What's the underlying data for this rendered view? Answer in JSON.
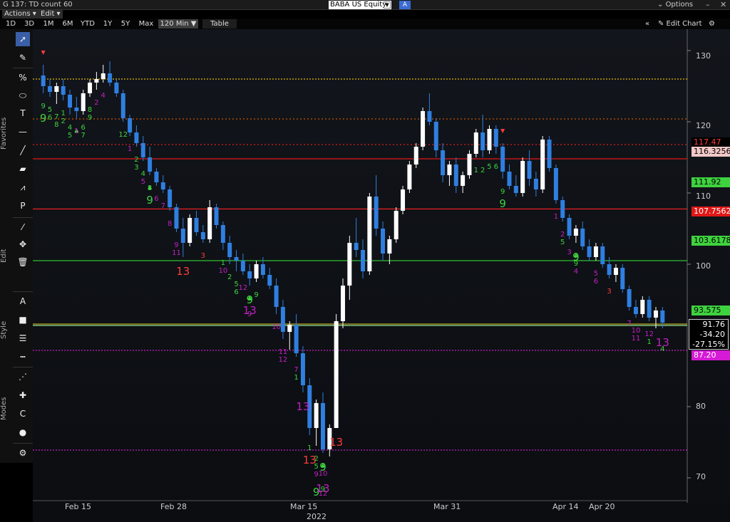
{
  "window": {
    "title": "G 137: TD count 60",
    "security": "BABA US Equity",
    "a_button": "A",
    "options_label": "Options",
    "controls": [
      "–",
      "✕"
    ]
  },
  "menu": {
    "actions": "Actions ▾",
    "edit": "Edit ▾"
  },
  "ranges": [
    "1D",
    "3D",
    "1M",
    "6M",
    "YTD",
    "1Y",
    "5Y",
    "Max",
    "120 Min ▼"
  ],
  "selected_range": "120 Min ▼",
  "table_label": "Table",
  "edit_chart_label": "✎ Edit Chart",
  "toolbar": {
    "groups": [
      "Favorites",
      "Edit",
      "Style",
      "Modes"
    ],
    "tools": [
      "pointer-tool",
      "pencil-tool",
      "percent-tool",
      "ellipse-tool",
      "text-tool",
      "horizontal-line-tool",
      "trend-line-tool",
      "channel-tool",
      "polyline-tool",
      "label-tool",
      "brush-tool",
      "move-tool",
      "delete-tool",
      "annotate-tool",
      "fill-tool",
      "line-weight-tool",
      "line-style-tool",
      "dashed-line-tool",
      "crosshair-tool",
      "magnet-tool",
      "colors-tool",
      "settings-tool"
    ]
  },
  "axes": {
    "y_ticks": [
      "130",
      "120",
      "110",
      "100",
      "80",
      "70"
    ],
    "x_ticks": [
      "Feb 15",
      "Feb 28",
      "Mar 15",
      "Mar 31",
      "Apr 14",
      "Apr 20"
    ],
    "year": "2022"
  },
  "price_tags": [
    {
      "value": "117.47",
      "fg": "#ff3b3b",
      "bg": "#000000"
    },
    {
      "value": "116.3256",
      "fg": "#000000",
      "bg": "#f2c7c7"
    },
    {
      "value": "111.92",
      "fg": "#000000",
      "bg": "#3fd23f"
    },
    {
      "value": "107.7562",
      "fg": "#ffffff",
      "bg": "#e01818"
    },
    {
      "value": "103.6178",
      "fg": "#000000",
      "bg": "#3fd23f"
    },
    {
      "value": "93.575",
      "fg": "#000000",
      "bg": "#3fd23f"
    },
    {
      "value": "87.20",
      "fg": "#ffffff",
      "bg": "#d61ad6"
    }
  ],
  "last_quote": {
    "price": "91.76",
    "change": "-34.20",
    "pct": "-27.15%"
  },
  "chart_data": {
    "type": "candlestick",
    "ylim": [
      67,
      133
    ],
    "colors": {
      "up": "#ffffff",
      "down": "#2f7fe0"
    },
    "candles": [
      [
        126.5,
        128.0,
        124.0,
        125.0
      ],
      [
        125.0,
        126.0,
        123.5,
        124.2
      ],
      [
        124.2,
        125.5,
        122.5,
        125.0
      ],
      [
        125.0,
        126.0,
        123.0,
        123.8
      ],
      [
        123.8,
        124.5,
        121.0,
        122.0
      ],
      [
        122.0,
        123.5,
        120.5,
        121.5
      ],
      [
        121.5,
        124.5,
        121.0,
        124.0
      ],
      [
        124.0,
        126.0,
        123.5,
        125.5
      ],
      [
        125.5,
        127.0,
        124.5,
        126.0
      ],
      [
        126.0,
        128.0,
        125.5,
        126.8
      ],
      [
        126.8,
        128.5,
        125.0,
        125.5
      ],
      [
        125.5,
        126.0,
        123.5,
        124.0
      ],
      [
        124.0,
        124.5,
        120.0,
        120.5
      ],
      [
        120.5,
        121.0,
        118.0,
        118.5
      ],
      [
        118.5,
        119.5,
        116.5,
        117.0
      ],
      [
        117.0,
        118.0,
        114.5,
        115.0
      ],
      [
        115.0,
        116.5,
        112.5,
        113.0
      ],
      [
        113.0,
        113.5,
        111.0,
        111.5
      ],
      [
        111.5,
        112.5,
        110.0,
        110.5
      ],
      [
        110.5,
        111.0,
        107.5,
        108.0
      ],
      [
        108.0,
        108.5,
        104.5,
        105.0
      ],
      [
        105.0,
        106.5,
        101.0,
        103.0
      ],
      [
        103.0,
        107.0,
        102.5,
        106.5
      ],
      [
        106.5,
        107.5,
        104.0,
        104.5
      ],
      [
        104.5,
        105.5,
        103.0,
        103.5
      ],
      [
        103.5,
        109.0,
        103.0,
        108.0
      ],
      [
        108.0,
        108.5,
        105.0,
        105.5
      ],
      [
        105.5,
        106.0,
        102.0,
        103.0
      ],
      [
        103.0,
        104.0,
        100.0,
        101.0
      ],
      [
        101.0,
        102.0,
        99.0,
        100.5
      ],
      [
        100.5,
        101.5,
        98.5,
        99.0
      ],
      [
        99.0,
        100.0,
        97.0,
        98.0
      ],
      [
        98.0,
        100.5,
        97.5,
        100.0
      ],
      [
        100.0,
        101.0,
        98.0,
        98.5
      ],
      [
        98.5,
        99.5,
        96.5,
        97.0
      ],
      [
        97.0,
        98.0,
        93.0,
        94.0
      ],
      [
        94.0,
        95.0,
        89.5,
        90.5
      ],
      [
        90.5,
        92.0,
        88.0,
        91.5
      ],
      [
        91.5,
        93.0,
        87.0,
        87.5
      ],
      [
        87.5,
        88.5,
        82.0,
        83.0
      ],
      [
        83.0,
        84.0,
        76.0,
        77.0
      ],
      [
        77.0,
        81.0,
        74.5,
        80.5
      ],
      [
        80.5,
        82.0,
        73.5,
        74.0
      ],
      [
        74.0,
        77.5,
        73.0,
        77.0
      ],
      [
        77.0,
        93.0,
        77.0,
        92.0
      ],
      [
        92.0,
        98.0,
        91.0,
        97.0
      ],
      [
        97.0,
        104.0,
        95.0,
        103.0
      ],
      [
        103.0,
        106.5,
        101.0,
        102.0
      ],
      [
        102.0,
        103.5,
        98.0,
        99.0
      ],
      [
        99.0,
        110.0,
        98.5,
        109.5
      ],
      [
        109.5,
        112.5,
        104.0,
        105.0
      ],
      [
        105.0,
        106.0,
        100.5,
        101.5
      ],
      [
        101.5,
        104.0,
        100.0,
        103.5
      ],
      [
        103.5,
        108.0,
        103.0,
        107.5
      ],
      [
        107.5,
        111.0,
        107.0,
        110.5
      ],
      [
        110.5,
        114.5,
        110.0,
        114.0
      ],
      [
        114.0,
        117.0,
        113.5,
        116.5
      ],
      [
        116.5,
        122.0,
        116.0,
        121.5
      ],
      [
        121.5,
        124.0,
        119.5,
        120.0
      ],
      [
        120.0,
        120.5,
        115.0,
        116.0
      ],
      [
        116.0,
        117.0,
        111.5,
        112.5
      ],
      [
        112.5,
        114.5,
        111.0,
        114.0
      ],
      [
        114.0,
        115.0,
        110.0,
        111.0
      ],
      [
        111.0,
        113.0,
        110.0,
        112.5
      ],
      [
        112.5,
        116.0,
        112.0,
        115.5
      ],
      [
        115.5,
        119.0,
        115.0,
        118.5
      ],
      [
        118.5,
        121.0,
        115.0,
        116.0
      ],
      [
        116.0,
        119.5,
        115.5,
        119.0
      ],
      [
        119.0,
        119.5,
        115.5,
        116.5
      ],
      [
        116.5,
        117.0,
        112.0,
        113.0
      ],
      [
        113.0,
        114.0,
        110.5,
        111.0
      ],
      [
        111.0,
        112.5,
        109.5,
        110.0
      ],
      [
        110.0,
        115.0,
        109.5,
        114.5
      ],
      [
        114.5,
        116.0,
        111.0,
        112.0
      ],
      [
        112.0,
        113.0,
        109.5,
        110.5
      ],
      [
        110.5,
        118.0,
        110.0,
        117.5
      ],
      [
        117.5,
        118.0,
        113.0,
        113.5
      ],
      [
        113.5,
        114.0,
        108.5,
        109.0
      ],
      [
        109.0,
        109.5,
        106.0,
        106.5
      ],
      [
        106.5,
        107.0,
        103.5,
        104.0
      ],
      [
        104.0,
        105.5,
        103.0,
        105.0
      ],
      [
        105.0,
        106.0,
        102.0,
        102.5
      ],
      [
        102.5,
        103.5,
        100.5,
        101.0
      ],
      [
        101.0,
        103.0,
        100.5,
        102.5
      ],
      [
        102.5,
        103.0,
        99.5,
        100.0
      ],
      [
        100.0,
        101.0,
        98.0,
        98.5
      ],
      [
        98.5,
        100.0,
        97.5,
        99.5
      ],
      [
        99.5,
        100.0,
        96.0,
        96.5
      ],
      [
        96.5,
        97.0,
        93.5,
        94.0
      ],
      [
        94.0,
        95.0,
        92.5,
        93.0
      ],
      [
        93.0,
        95.5,
        92.5,
        95.0
      ],
      [
        95.0,
        95.5,
        92.0,
        92.5
      ],
      [
        92.5,
        94.0,
        91.0,
        93.5
      ],
      [
        93.5,
        94.0,
        91.0,
        91.8
      ]
    ],
    "levels": [
      {
        "price": 126.0,
        "color": "#e6b800",
        "dash": "2,2"
      },
      {
        "price": 120.4,
        "color": "#cc5500",
        "dash": "2,3"
      },
      {
        "price": 116.8,
        "color": "#d62020",
        "dash": "2,3"
      },
      {
        "price": 114.8,
        "color": "#e01818",
        "dash": ""
      },
      {
        "price": 107.7562,
        "color": "#ff2020",
        "dash": ""
      },
      {
        "price": 100.5,
        "color": "#30c030",
        "dash": ""
      },
      {
        "price": 91.4,
        "color": "#8fe68f",
        "dash": ""
      },
      {
        "price": 91.6,
        "color": "#b8a020",
        "dash": ""
      },
      {
        "price": 87.9,
        "color": "#c020c0",
        "dash": "2,2"
      },
      {
        "price": 73.9,
        "color": "#c020c0",
        "dash": "2,2"
      }
    ],
    "counts": [
      {
        "t": "9",
        "c": "#3fd23f",
        "big": false,
        "bar": 0
      },
      {
        "t": "9",
        "c": "#3fd23f",
        "big": true,
        "bar": 0
      },
      {
        "t": "5",
        "c": "#3fd23f",
        "big": false,
        "bar": 1
      },
      {
        "t": "6",
        "c": "#3fd23f",
        "big": false,
        "bar": 1
      },
      {
        "t": "7",
        "c": "#3fd23f",
        "big": false,
        "bar": 2
      },
      {
        "t": "8",
        "c": "#3fd23f",
        "big": false,
        "bar": 2
      },
      {
        "t": "1",
        "c": "#3fd23f",
        "big": false,
        "bar": 3
      },
      {
        "t": "2",
        "c": "#3fd23f",
        "big": false,
        "bar": 3
      },
      {
        "t": "4",
        "c": "#3fd23f",
        "big": false,
        "bar": 4
      },
      {
        "t": "5",
        "c": "#3fd23f",
        "big": false,
        "bar": 4
      },
      {
        "t": "1",
        "c": "#c020c0",
        "big": false,
        "bar": 5
      },
      {
        "t": "6",
        "c": "#3fd23f",
        "big": false,
        "bar": 6
      },
      {
        "t": "7",
        "c": "#3fd23f",
        "big": false,
        "bar": 6
      },
      {
        "t": "8",
        "c": "#3fd23f",
        "big": false,
        "bar": 7
      },
      {
        "t": "9",
        "c": "#3fd23f",
        "big": false,
        "bar": 7
      },
      {
        "t": "2",
        "c": "#c020c0",
        "big": false,
        "bar": 8
      },
      {
        "t": "4",
        "c": "#c020c0",
        "big": false,
        "bar": 9
      },
      {
        "t": "12",
        "c": "#3fd23f",
        "big": false,
        "bar": 12
      },
      {
        "t": "1",
        "c": "#c020c0",
        "big": false,
        "bar": 13
      },
      {
        "t": "2",
        "c": "#3fd23f",
        "big": false,
        "bar": 14
      },
      {
        "t": "3",
        "c": "#3fd23f",
        "big": false,
        "bar": 14
      },
      {
        "t": "4",
        "c": "#3fd23f",
        "big": false,
        "bar": 15
      },
      {
        "t": "5",
        "c": "#c020c0",
        "big": false,
        "bar": 15
      },
      {
        "t": "8",
        "c": "#3fd23f",
        "big": false,
        "bar": 16
      },
      {
        "t": "9",
        "c": "#3fd23f",
        "big": true,
        "bar": 16
      },
      {
        "t": "6",
        "c": "#c020c0",
        "big": false,
        "bar": 17
      },
      {
        "t": "7",
        "c": "#c020c0",
        "big": false,
        "bar": 18
      },
      {
        "t": "8",
        "c": "#c020c0",
        "big": false,
        "bar": 19
      },
      {
        "t": "13",
        "c": "#ff3b3b",
        "big": true,
        "bar": 21
      },
      {
        "t": "9",
        "c": "#c020c0",
        "big": false,
        "bar": 20
      },
      {
        "t": "11",
        "c": "#c020c0",
        "big": false,
        "bar": 20
      },
      {
        "t": "3",
        "c": "#ff3b3b",
        "big": false,
        "bar": 24
      },
      {
        "t": "1",
        "c": "#3fd23f",
        "big": false,
        "bar": 27
      },
      {
        "t": "2",
        "c": "#3fd23f",
        "big": false,
        "bar": 28
      },
      {
        "t": "5",
        "c": "#3fd23f",
        "big": false,
        "bar": 29
      },
      {
        "t": "6",
        "c": "#3fd23f",
        "big": false,
        "bar": 29
      },
      {
        "t": "9",
        "c": "#3fd23f",
        "big": true,
        "bar": 31
      },
      {
        "t": "10",
        "c": "#c020c0",
        "big": false,
        "bar": 27
      },
      {
        "t": "12",
        "c": "#c020c0",
        "big": false,
        "bar": 30
      },
      {
        "t": "13",
        "c": "#c020c0",
        "big": true,
        "bar": 31
      },
      {
        "t": "9",
        "c": "#3fd23f",
        "big": false,
        "bar": 32
      },
      {
        "t": "9",
        "c": "#c020c0",
        "big": false,
        "bar": 31
      },
      {
        "t": "10",
        "c": "#c020c0",
        "big": false,
        "bar": 35
      },
      {
        "t": "11",
        "c": "#c020c0",
        "big": false,
        "bar": 36
      },
      {
        "t": "7",
        "c": "#c020c0",
        "big": false,
        "bar": 38
      },
      {
        "t": "12",
        "c": "#c020c0",
        "big": false,
        "bar": 36
      },
      {
        "t": "1",
        "c": "#3fd23f",
        "big": false,
        "bar": 40
      },
      {
        "t": "13",
        "c": "#ff3b3b",
        "big": true,
        "bar": 40
      },
      {
        "t": "2",
        "c": "#3fd23f",
        "big": false,
        "bar": 41
      },
      {
        "t": "1",
        "c": "#3fd23f",
        "big": false,
        "bar": 38
      },
      {
        "t": "13",
        "c": "#c020c0",
        "big": true,
        "bar": 39
      },
      {
        "t": "5",
        "c": "#3fd23f",
        "big": false,
        "bar": 41
      },
      {
        "t": "9",
        "c": "#3fd23f",
        "big": true,
        "bar": 42
      },
      {
        "t": "9",
        "c": "#c020c0",
        "big": false,
        "bar": 41
      },
      {
        "t": "10",
        "c": "#c020c0",
        "big": false,
        "bar": 42
      },
      {
        "t": "9",
        "c": "#3fd23f",
        "big": true,
        "bar": 41
      },
      {
        "t": "13",
        "c": "#c020c0",
        "big": true,
        "bar": 42
      },
      {
        "t": "13",
        "c": "#ff3b3b",
        "big": true,
        "bar": 44
      },
      {
        "t": "9",
        "c": "#3fd23f",
        "big": false,
        "bar": 42
      },
      {
        "t": "12",
        "c": "#c020c0",
        "big": false,
        "bar": 42
      },
      {
        "t": "9",
        "c": "#3fd23f",
        "big": false,
        "bar": 69
      },
      {
        "t": "9",
        "c": "#3fd23f",
        "big": true,
        "bar": 69
      },
      {
        "t": "5",
        "c": "#3fd23f",
        "big": false,
        "bar": 67
      },
      {
        "t": "6",
        "c": "#3fd23f",
        "big": false,
        "bar": 68
      },
      {
        "t": "1",
        "c": "#3fd23f",
        "big": false,
        "bar": 65
      },
      {
        "t": "2",
        "c": "#3fd23f",
        "big": false,
        "bar": 66
      },
      {
        "t": "1",
        "c": "#c020c0",
        "big": false,
        "bar": 77
      },
      {
        "t": "2",
        "c": "#c020c0",
        "big": false,
        "bar": 78
      },
      {
        "t": "5",
        "c": "#3fd23f",
        "big": false,
        "bar": 78
      },
      {
        "t": "3",
        "c": "#c020c0",
        "big": false,
        "bar": 79
      },
      {
        "t": "9",
        "c": "#3fd23f",
        "big": true,
        "bar": 80
      },
      {
        "t": "9",
        "c": "#3fd23f",
        "big": false,
        "bar": 80
      },
      {
        "t": "4",
        "c": "#c020c0",
        "big": false,
        "bar": 80
      },
      {
        "t": "5",
        "c": "#c020c0",
        "big": false,
        "bar": 83
      },
      {
        "t": "6",
        "c": "#c020c0",
        "big": false,
        "bar": 83
      },
      {
        "t": "3",
        "c": "#ff3b3b",
        "big": false,
        "bar": 85
      },
      {
        "t": "7",
        "c": "#c020c0",
        "big": false,
        "bar": 88
      },
      {
        "t": "10",
        "c": "#c020c0",
        "big": false,
        "bar": 89
      },
      {
        "t": "11",
        "c": "#c020c0",
        "big": false,
        "bar": 89
      },
      {
        "t": "12",
        "c": "#c020c0",
        "big": false,
        "bar": 91
      },
      {
        "t": "1",
        "c": "#3fd23f",
        "big": false,
        "bar": 91
      },
      {
        "t": "13",
        "c": "#c020c0",
        "big": true,
        "bar": 93
      },
      {
        "t": "4",
        "c": "#3fd23f",
        "big": false,
        "bar": 93
      }
    ],
    "arrows": [
      {
        "dir": "down",
        "c": "#ff3b3b",
        "bar": 0
      },
      {
        "dir": "down",
        "c": "#ff3b3b",
        "bar": 69
      },
      {
        "dir": "up",
        "c": "#3fd23f",
        "bar": 5
      },
      {
        "dir": "up",
        "c": "#3fd23f",
        "bar": 16
      },
      {
        "dir": "up",
        "c": "#3fd23f",
        "bar": 31
      },
      {
        "dir": "up",
        "c": "#3fd23f",
        "bar": 42
      },
      {
        "dir": "up",
        "c": "#3fd23f",
        "bar": 80
      }
    ]
  }
}
